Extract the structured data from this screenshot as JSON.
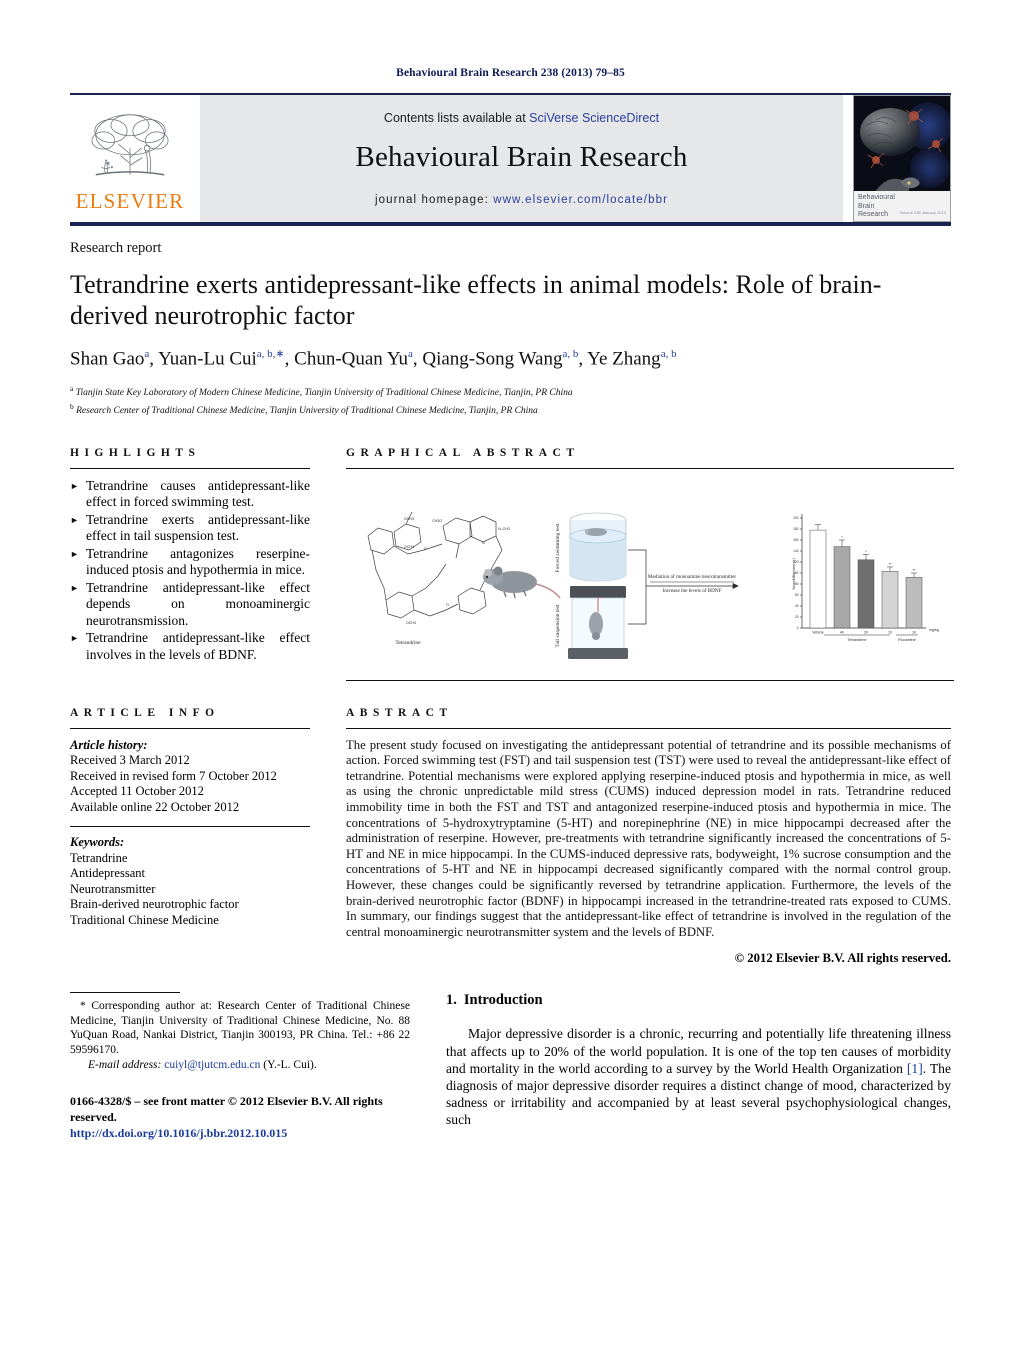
{
  "running_head": "Behavioural Brain Research 238 (2013) 79–85",
  "masthead": {
    "contents_prefix": "Contents lists available at ",
    "contents_link": "SciVerse ScienceDirect",
    "journal_name": "Behavioural Brain Research",
    "homepage_prefix": "journal homepage: ",
    "homepage_url": "www.elsevier.com/locate/bbr",
    "publisher_logo_text": "ELSEVIER",
    "cover_title_line1": "Behavioural",
    "cover_title_line2": "Brain",
    "cover_title_line3": "Research",
    "cover_tiny": "Volume 238  January 2013"
  },
  "article": {
    "type": "Research report",
    "title": "Tetrandrine exerts antidepressant-like effects in animal models: Role of brain-derived neurotrophic factor",
    "authors": [
      {
        "name": "Shan Gao",
        "sup": "a",
        "sep": ", "
      },
      {
        "name": "Yuan-Lu Cui",
        "sup": "a, b,∗",
        "sep": ", "
      },
      {
        "name": "Chun-Quan Yu",
        "sup": "a",
        "sep": ", "
      },
      {
        "name": "Qiang-Song Wang",
        "sup": "a, b",
        "sep": ", "
      },
      {
        "name": "Ye Zhang",
        "sup": "a, b",
        "sep": ""
      }
    ],
    "affiliations": [
      {
        "marker": "a",
        "text": "Tianjin State Key Laboratory of Modern Chinese Medicine, Tianjin University of Traditional Chinese Medicine, Tianjin, PR China"
      },
      {
        "marker": "b",
        "text": "Research Center of Traditional Chinese Medicine, Tianjin University of Traditional Chinese Medicine, Tianjin, PR China"
      }
    ]
  },
  "highlights": {
    "heading": "HIGHLIGHTS",
    "items": [
      "Tetrandrine causes antidepressant-like effect in forced swimming test.",
      "Tetrandrine exerts antidepressant-like effect in tail suspension test.",
      "Tetrandrine antagonizes reserpine-induced ptosis and hypothermia in mice.",
      "Tetrandrine antidepressant-like effect depends on monoaminergic neurotransmission.",
      "Tetrandrine antidepressant-like effect involves in the levels of BDNF."
    ]
  },
  "graphical_abstract": {
    "heading": "GRAPHICAL ABSTRACT",
    "molecule_label": "Tetrandrine",
    "test_label_top": "Forced swimming test",
    "test_label_bottom": "Tail suspension test",
    "arrow_label_line1": "Mediation of monoamine neurotransmitter",
    "arrow_label_line2": "Increase the levels of BDNF",
    "chart": {
      "ylabel": "Immobility time (s)",
      "unit_label": "mg/kg",
      "categories": [
        "Vehicle",
        "40",
        "20",
        "10",
        "10"
      ],
      "group_labels": [
        "Tetrandrine",
        "Fluoxetine"
      ],
      "values": [
        178,
        148,
        124,
        103,
        92
      ],
      "errors": [
        10,
        12,
        10,
        8,
        8
      ],
      "significance": [
        "",
        "*",
        "*",
        "**",
        "**"
      ],
      "yticks": [
        "0",
        "20",
        "40",
        "60",
        "80",
        "100",
        "120",
        "140",
        "160",
        "180",
        "200"
      ]
    }
  },
  "article_info": {
    "heading": "ARTICLE INFO",
    "history_label": "Article history:",
    "history": [
      "Received 3 March 2012",
      "Received in revised form 7 October 2012",
      "Accepted 11 October 2012",
      "Available online 22 October 2012"
    ],
    "keywords_label": "Keywords:",
    "keywords": [
      "Tetrandrine",
      "Antidepressant",
      "Neurotransmitter",
      "Brain-derived neurotrophic factor",
      "Traditional Chinese Medicine"
    ]
  },
  "abstract": {
    "heading": "ABSTRACT",
    "text": "The present study focused on investigating the antidepressant potential of tetrandrine and its possible mechanisms of action. Forced swimming test (FST) and tail suspension test (TST) were used to reveal the antidepressant-like effect of tetrandrine. Potential mechanisms were explored applying reserpine-induced ptosis and hypothermia in mice, as well as using the chronic unpredictable mild stress (CUMS) induced depression model in rats. Tetrandrine reduced immobility time in both the FST and TST and antagonized reserpine-induced ptosis and hypothermia in mice. The concentrations of 5-hydroxytryptamine (5-HT) and norepinephrine (NE) in mice hippocampi decreased after the administration of reserpine. However, pre-treatments with tetrandrine significantly increased the concentrations of 5-HT and NE in mice hippocampi. In the CUMS-induced depressive rats, bodyweight, 1% sucrose consumption and the concentrations of 5-HT and NE in hippocampi decreased significantly compared with the normal control group. However, these changes could be significantly reversed by tetrandrine application. Furthermore, the levels of the brain-derived neurotrophic factor (BDNF) in hippocampi increased in the tetrandrine-treated rats exposed to CUMS. In summary, our findings suggest that the antidepressant-like effect of tetrandrine is involved in the regulation of the central monoaminergic neurotransmitter system and the levels of BDNF.",
    "copyright": "© 2012 Elsevier B.V. All rights reserved."
  },
  "introduction": {
    "number": "1.",
    "heading": "Introduction",
    "paragraph_before_cite": "Major depressive disorder is a chronic, recurring and potentially life threatening illness that affects up to 20% of the world population. It is one of the top ten causes of morbidity and mortality in the world according to a survey by the World Health Organization ",
    "citation": "[1]",
    "paragraph_after_cite": ". The diagnosis of major depressive disorder requires a distinct change of mood, characterized by sadness or irritability and accompanied by at least several psychophysiological changes, such"
  },
  "footer": {
    "corresponding_marker": "*",
    "corresponding_text": "Corresponding author at: Research Center of Traditional Chinese Medicine, Tianjin University of Traditional Chinese Medicine, No. 88 YuQuan Road, Nankai District, Tianjin 300193, PR China. Tel.: +86 22 59596170.",
    "email_label": "E-mail address:",
    "email": "cuiyl@tjutcm.edu.cn",
    "email_attrib": "(Y.-L. Cui).",
    "front_matter": "0166-4328/$ – see front matter © 2012 Elsevier B.V. All rights reserved.",
    "doi": "http://dx.doi.org/10.1016/j.bbr.2012.10.015"
  },
  "colors": {
    "link": "#1a3a9e",
    "header_navy": "#17224f",
    "elsevier_orange": "#eb7b10",
    "masthead_gray": "#e6e7e9"
  }
}
